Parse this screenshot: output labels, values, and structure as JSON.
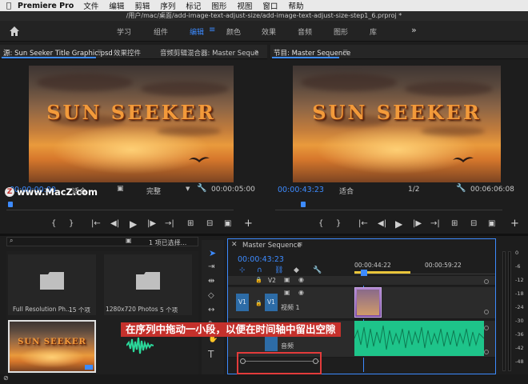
{
  "menubar": {
    "app": "Premiere Pro",
    "items": [
      "文件",
      "编辑",
      "剪辑",
      "序列",
      "标记",
      "图形",
      "视图",
      "窗口",
      "帮助"
    ]
  },
  "window": {
    "path": "/用户/mac/桌面/add-image-text-adjust-size/add-image-text-adjust-size-step1_6.prproj *"
  },
  "workspaces": {
    "items": [
      "学习",
      "组件",
      "编辑",
      "颜色",
      "效果",
      "音频",
      "图形",
      "库"
    ],
    "active": "编辑"
  },
  "source_panel": {
    "tabs": [
      "源: Sun Seeker Title Graphic.psd",
      "效果控件",
      "音频剪辑混合器: Master Seque"
    ],
    "title_text": "SUN SEEKER",
    "timecode": "00:00:00:00",
    "zoom": "适合",
    "quality": "完整",
    "duration": "00:00:05:00"
  },
  "program_panel": {
    "tab": "节目: Master Sequence",
    "title_text": "SUN SEEKER",
    "timecode": "00:00:43:23",
    "zoom": "适合",
    "fraction": "1/2",
    "duration": "00:06:06:08"
  },
  "watermark": "www.MacZ.com",
  "project_panel": {
    "selection": "1 项已选择...",
    "bins": [
      {
        "name": "Full Resolution Ph...",
        "count": "15 个项"
      },
      {
        "name": "1280x720 Photos",
        "count": "5 个项"
      }
    ],
    "thumb_text": "SUN SEEKER"
  },
  "timeline": {
    "tab": "Master Sequence",
    "timecode": "00:00:43:23",
    "ruler": [
      "00:00:44:22",
      "00:00:59:22"
    ],
    "tracks": {
      "v2": "V2",
      "v1": "V1",
      "v1_name": "视频 1",
      "a1_name": "音频"
    }
  },
  "meter_labels": [
    "0",
    "-6",
    "-12",
    "-18",
    "-24",
    "-30",
    "-36",
    "-42",
    "-48"
  ],
  "callout": "在序列中拖动一小段，以便在时间轴中留出空隙",
  "colors": {
    "accent": "#3d8bff",
    "audio_clip": "#2bd89a",
    "video_clip": "#9a5fc0",
    "callout_bg": "#c5312c",
    "highlight_box": "#e23b3b"
  }
}
